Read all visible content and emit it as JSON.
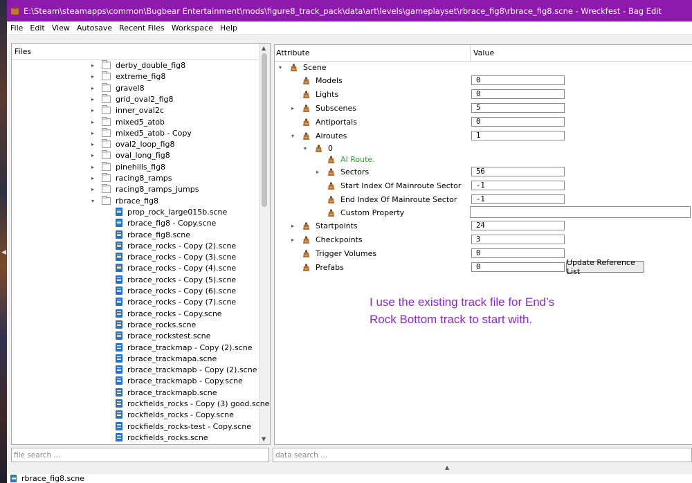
{
  "window": {
    "title": "E:\\Steam\\steamapps\\common\\Bugbear Entertainment\\mods\\figure8_track_pack\\data\\art\\levels\\gameplayset\\rbrace_fig8\\rbrace_fig8.scne - Wreckfest - Bag Edit",
    "accent": "#8e19ad"
  },
  "menu": [
    "File",
    "Edit",
    "View",
    "Autosave",
    "Recent Files",
    "Workspace",
    "Help"
  ],
  "files_panel": {
    "header": "Files",
    "folders": [
      "derby_double_fig8",
      "extreme_fig8",
      "gravel8",
      "grid_oval2_fig8",
      "inner_oval2c",
      "mixed5_atob",
      "mixed5_atob - Copy",
      "oval2_loop_fig8",
      "oval_long_fig8",
      "pinehills_fig8",
      "racing8_ramps",
      "racing8_ramps_jumps"
    ],
    "open_folder": "rbrace_fig8",
    "files": [
      "prop_rock_large015b.scne",
      "rbrace_fig8 - Copy.scne",
      "rbrace_fig8.scne",
      "rbrace_rocks - Copy (2).scne",
      "rbrace_rocks - Copy (3).scne",
      "rbrace_rocks - Copy (4).scne",
      "rbrace_rocks - Copy (5).scne",
      "rbrace_rocks - Copy (6).scne",
      "rbrace_rocks - Copy (7).scne",
      "rbrace_rocks - Copy.scne",
      "rbrace_rocks.scne",
      "rbrace_rockstest.scne",
      "rbrace_trackmap - Copy (2).scne",
      "rbrace_trackmapa.scne",
      "rbrace_trackmapb - Copy (2).scne",
      "rbrace_trackmapb - Copy.scne",
      "rbrace_trackmapb.scne",
      "rockfields_rocks - Copy (3) good.scne",
      "rockfields_rocks - Copy.scne",
      "rockfields_rocks-test - Copy.scne",
      "rockfields_rocks.scne"
    ],
    "search_placeholder": "file search ..."
  },
  "attributes_panel": {
    "col_attribute": "Attribute",
    "col_value": "Value",
    "rows": [
      {
        "label": "Scene",
        "value": null,
        "expander": "open"
      },
      {
        "label": "Models",
        "value": "0",
        "expander": ""
      },
      {
        "label": "Lights",
        "value": "0",
        "expander": ""
      },
      {
        "label": "Subscenes",
        "value": "5",
        "expander": "closed"
      },
      {
        "label": "Antiportals",
        "value": "0",
        "expander": ""
      },
      {
        "label": "Airoutes",
        "value": "1",
        "expander": "open"
      },
      {
        "label": "0",
        "value": null,
        "expander": "open"
      },
      {
        "label": "AI Route.",
        "value": null,
        "expander": ""
      },
      {
        "label": "Sectors",
        "value": "56",
        "expander": "closed"
      },
      {
        "label": "Start Index Of Mainroute Sector",
        "value": "-1",
        "expander": ""
      },
      {
        "label": "End Index Of Mainroute Sector",
        "value": "-1",
        "expander": ""
      },
      {
        "label": "Custom Property",
        "value": "",
        "expander": ""
      },
      {
        "label": "Startpoints",
        "value": "24",
        "expander": "closed"
      },
      {
        "label": "Checkpoints",
        "value": "3",
        "expander": "closed"
      },
      {
        "label": "Trigger Volumes",
        "value": "0",
        "expander": ""
      },
      {
        "label": "Prefabs",
        "value": "0",
        "expander": ""
      }
    ],
    "update_button": "Update Reference List",
    "search_placeholder": "data search ..."
  },
  "annotation": {
    "line1": "I use the existing track file for End’s",
    "line2": "Rock Bottom track to start with.",
    "color": "#8c28d8"
  },
  "status": {
    "file": "rbrace_fig8.scne"
  }
}
